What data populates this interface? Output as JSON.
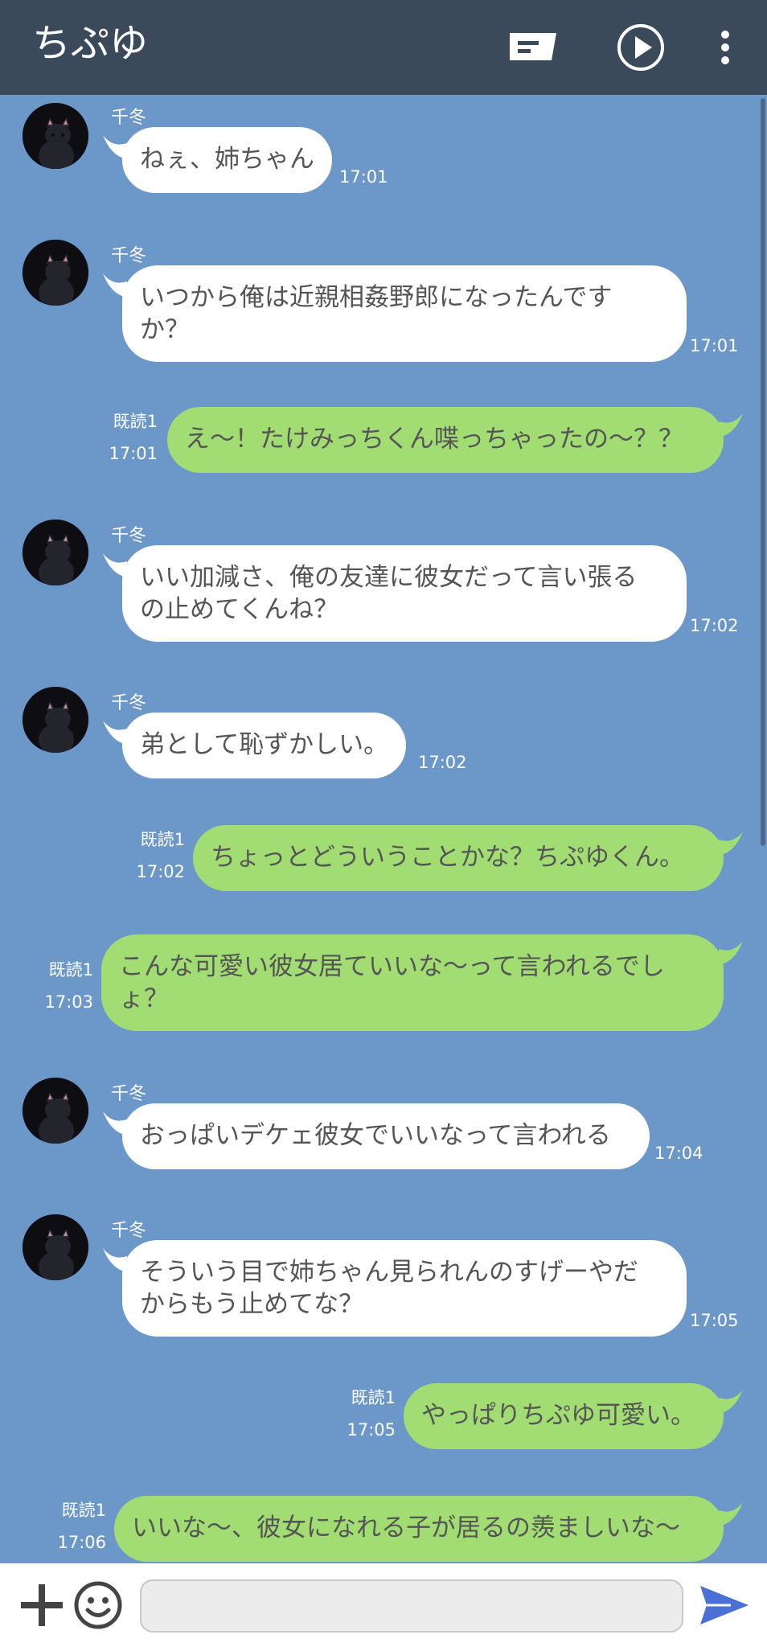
{
  "header": {
    "title": "ちぷゆ",
    "icons": [
      "list-icon",
      "play-icon",
      "more-vertical-icon"
    ]
  },
  "messages": [
    {
      "side": "in",
      "sender": "千冬",
      "lines": [
        "ねぇ、姉ちゃん"
      ],
      "time": "17:01"
    },
    {
      "side": "in",
      "sender": "千冬",
      "lines": [
        "いつから俺は近親相姦野郎になったんです",
        "か？"
      ],
      "time": "17:01"
    },
    {
      "side": "out",
      "read": "既読1",
      "lines": [
        "え〜！たけみっちくん喋っちゃったの〜？？"
      ],
      "time": "17:01"
    },
    {
      "side": "in",
      "sender": "千冬",
      "lines": [
        "いい加減さ、俺の友達に彼女だって言い張る",
        "の止めてくんね？"
      ],
      "time": "17:02"
    },
    {
      "side": "in",
      "sender": "千冬",
      "lines": [
        "弟として恥ずかしい。"
      ],
      "time": "17:02"
    },
    {
      "side": "out",
      "read": "既読1",
      "lines": [
        "ちょっとどういうことかな？ちぷゆくん。"
      ],
      "time": "17:02"
    },
    {
      "side": "out",
      "read": "既読1",
      "lines": [
        "こんな可愛い彼女居ていいな〜って言われるでし",
        "ょ？"
      ],
      "time": "17:03"
    },
    {
      "side": "in",
      "sender": "千冬",
      "lines": [
        "おっぱいデケェ彼女でいいなって言われる"
      ],
      "time": "17:04"
    },
    {
      "side": "in",
      "sender": "千冬",
      "lines": [
        "そういう目で姉ちゃん見られんのすげーやだ",
        "からもう止めてな？"
      ],
      "time": "17:05"
    },
    {
      "side": "out",
      "read": "既読1",
      "lines": [
        "やっぱりちぷゆ可愛い。"
      ],
      "time": "17:05"
    },
    {
      "side": "out",
      "read": "既読1",
      "lines": [
        "いいな〜、彼女になれる子が居るの羨ましいな〜"
      ],
      "time": "17:06"
    }
  ],
  "input": {
    "placeholder": "",
    "value": ""
  },
  "colors": {
    "header_bg": "#3a4a5b",
    "chat_bg": "#6b98c9",
    "incoming_bubble": "#ffffff",
    "outgoing_bubble": "#a1dd72",
    "send_icon": "#4a6fd6"
  }
}
